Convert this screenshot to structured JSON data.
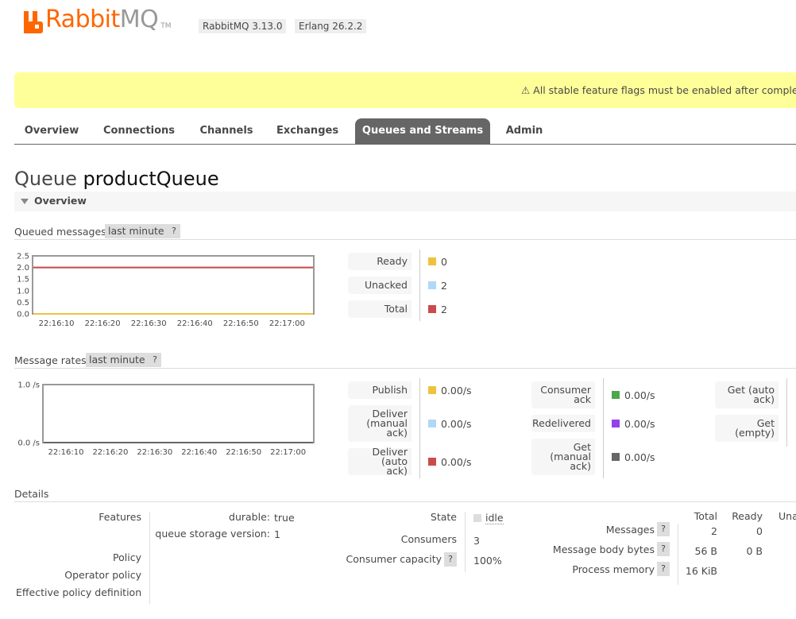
{
  "header": {
    "logo_part1": "Rabbit",
    "logo_part2": "MQ",
    "logo_tm": "TM",
    "rabbitmq_version": "RabbitMQ 3.13.0",
    "erlang_version": "Erlang 26.2.2"
  },
  "banner": {
    "text": "⚠ All stable feature flags must be enabled after completi"
  },
  "tabs": [
    {
      "label": "Overview"
    },
    {
      "label": "Connections"
    },
    {
      "label": "Channels"
    },
    {
      "label": "Exchanges"
    },
    {
      "label": "Queues and Streams",
      "active": true
    },
    {
      "label": "Admin"
    }
  ],
  "page": {
    "title_prefix": "Queue",
    "title_name": "productQueue",
    "section": "Overview"
  },
  "queued_messages": {
    "label": "Queued messages",
    "range": "last minute",
    "help": "?",
    "legend": [
      {
        "label": "Ready",
        "value": "0",
        "color": "#edc240"
      },
      {
        "label": "Unacked",
        "value": "2",
        "color": "#afd8f8"
      },
      {
        "label": "Total",
        "value": "2",
        "color": "#cb4b4b"
      }
    ]
  },
  "message_rates": {
    "label": "Message rates",
    "range": "last minute",
    "help": "?",
    "col1": [
      {
        "label": "Publish",
        "value": "0.00/s",
        "color": "#edc240"
      },
      {
        "label": "Deliver (manual ack)",
        "value": "0.00/s",
        "color": "#afd8f8"
      },
      {
        "label": "Deliver (auto ack)",
        "value": "0.00/s",
        "color": "#cb4b4b"
      }
    ],
    "col2": [
      {
        "label": "Consumer ack",
        "value": "0.00/s",
        "color": "#4da74d"
      },
      {
        "label": "Redelivered",
        "value": "0.00/s",
        "color": "#9440ed"
      },
      {
        "label": "Get (manual ack)",
        "value": "0.00/s",
        "color": "#666666"
      }
    ],
    "col3": [
      {
        "label": "Get (auto ack)"
      },
      {
        "label": "Get (empty)"
      }
    ]
  },
  "chart_data": [
    {
      "type": "line",
      "title": "Queued messages",
      "x": [
        "22:16:10",
        "22:16:20",
        "22:16:30",
        "22:16:40",
        "22:16:50",
        "22:17:00"
      ],
      "y_ticks": [
        "2.5",
        "2.0",
        "1.5",
        "1.0",
        "0.5",
        "0.0"
      ],
      "ylim": [
        0,
        2.5
      ],
      "series": [
        {
          "name": "Ready",
          "color": "#edc240",
          "values": [
            0,
            0,
            0,
            0,
            0,
            0
          ]
        },
        {
          "name": "Unacked",
          "color": "#afd8f8",
          "values": [
            2,
            2,
            2,
            2,
            2,
            2
          ]
        },
        {
          "name": "Total",
          "color": "#cb4b4b",
          "values": [
            2,
            2,
            2,
            2,
            2,
            2
          ]
        }
      ]
    },
    {
      "type": "line",
      "title": "Message rates",
      "x": [
        "22:16:10",
        "22:16:20",
        "22:16:30",
        "22:16:40",
        "22:16:50",
        "22:17:00"
      ],
      "y_ticks": [
        "1.0 /s",
        "0.0 /s"
      ],
      "ylim": [
        0,
        1
      ],
      "series": [
        {
          "name": "Publish",
          "color": "#edc240",
          "values": [
            0,
            0,
            0,
            0,
            0,
            0
          ]
        },
        {
          "name": "Deliver (manual ack)",
          "color": "#afd8f8",
          "values": [
            0,
            0,
            0,
            0,
            0,
            0
          ]
        },
        {
          "name": "Deliver (auto ack)",
          "color": "#cb4b4b",
          "values": [
            0,
            0,
            0,
            0,
            0,
            0
          ]
        },
        {
          "name": "Consumer ack",
          "color": "#4da74d",
          "values": [
            0,
            0,
            0,
            0,
            0,
            0
          ]
        },
        {
          "name": "Redelivered",
          "color": "#9440ed",
          "values": [
            0,
            0,
            0,
            0,
            0,
            0
          ]
        },
        {
          "name": "Get (manual ack)",
          "color": "#666666",
          "values": [
            0,
            0,
            0,
            0,
            0,
            0
          ]
        }
      ]
    }
  ],
  "details": {
    "label": "Details",
    "features_label": "Features",
    "durable_key": "durable:",
    "durable_val": "true",
    "storage_key": "queue storage version:",
    "storage_val": "1",
    "policy_label": "Policy",
    "operator_policy_label": "Operator policy",
    "effective_policy_label": "Effective policy definition",
    "state_label": "State",
    "state_value": "idle",
    "consumers_label": "Consumers",
    "consumers_value": "3",
    "capacity_label": "Consumer capacity",
    "capacity_value": "100%",
    "help": "?",
    "stats_headers": [
      "Total",
      "Ready",
      "Una"
    ],
    "stats_rows": [
      {
        "label": "Messages",
        "total": "2",
        "ready": "0"
      },
      {
        "label": "Message body bytes",
        "total": "56 B",
        "ready": "0 B"
      },
      {
        "label": "Process memory",
        "total": "16 KiB",
        "ready": ""
      }
    ]
  }
}
